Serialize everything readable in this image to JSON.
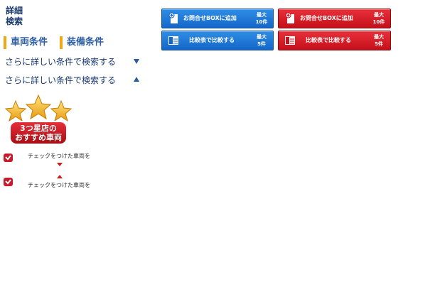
{
  "sidebar": {
    "detail_search_line1": "詳細",
    "detail_search_line2": "検索",
    "tabs": [
      {
        "label": "車両条件"
      },
      {
        "label": "装備条件"
      }
    ],
    "more_conditions": [
      {
        "label": "さらに詳しい条件で検索する",
        "arrow": "down"
      },
      {
        "label": "さらに詳しい条件で検索する",
        "arrow": "up"
      }
    ],
    "badge": {
      "line1": "3つ星店の",
      "line2": "おすすめ車両"
    },
    "checked_rows": [
      {
        "label": "チェックをつけた車両を"
      },
      {
        "label": "チェックをつけた車両を"
      }
    ]
  },
  "actions": {
    "add_box_blue": {
      "label": "お問合せBOXに追加",
      "limit1": "最大",
      "limit2": "10件"
    },
    "add_box_red": {
      "label": "お問合せBOXに追加",
      "limit1": "最大",
      "limit2": "10件"
    },
    "compare_blue": {
      "label": "比較表で比較する",
      "limit1": "最大",
      "limit2": "5件"
    },
    "compare_red": {
      "label": "比較表で比較する",
      "limit1": "最大",
      "limit2": "5件"
    }
  },
  "colors": {
    "blue_button": "#1a74d6",
    "red_button": "#d41c26",
    "tab_marker": "#f0a818",
    "link_text": "#1a3a6e"
  },
  "icons": {
    "add_box": "document-plus-icon",
    "compare": "comparison-table-icon",
    "check": "checkbox-checked-icon",
    "badge": "three-stars-icon"
  }
}
